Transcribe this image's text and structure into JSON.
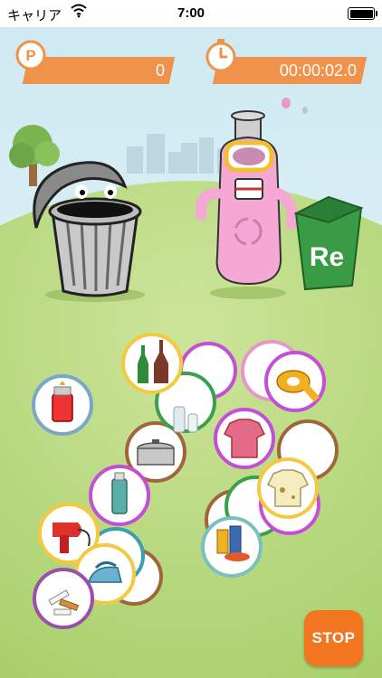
{
  "status_bar": {
    "carrier": "キャリア",
    "time": "7:00"
  },
  "hud": {
    "points_icon_letter": "P",
    "points_value": "0",
    "timer_value": "00:00:02.0"
  },
  "scene": {
    "recycle_bin_label": "Re"
  },
  "controls": {
    "stop_label": "STOP"
  },
  "colors": {
    "accent_orange": "#f0924a",
    "stop_orange": "#f2761f",
    "ground_green": "#b2d67a",
    "sky_blue": "#cfeaf2"
  },
  "items": [
    {
      "name": "lighter",
      "icon": "lighter-icon",
      "ring": "#7aa6c8"
    },
    {
      "name": "glass-bottles",
      "icon": "bottles-icon",
      "ring": "#f5c842"
    },
    {
      "name": "tape",
      "icon": "tape-icon",
      "ring": "#c24fd6"
    },
    {
      "name": "spray-can",
      "icon": "spray-can-icon",
      "ring": "#c24fd6"
    },
    {
      "name": "hair-dryer",
      "icon": "hair-dryer-icon",
      "ring": "#f5c842"
    },
    {
      "name": "cigarette-butts",
      "icon": "cigarette-icon",
      "ring": "#9a4fa8"
    },
    {
      "name": "cans",
      "icon": "cans-icon",
      "ring": "#7ac0c0"
    },
    {
      "name": "shirt",
      "icon": "shirt-icon",
      "ring": "#c24fd6"
    },
    {
      "name": "pot",
      "icon": "pot-icon",
      "ring": "#a0663a"
    }
  ]
}
